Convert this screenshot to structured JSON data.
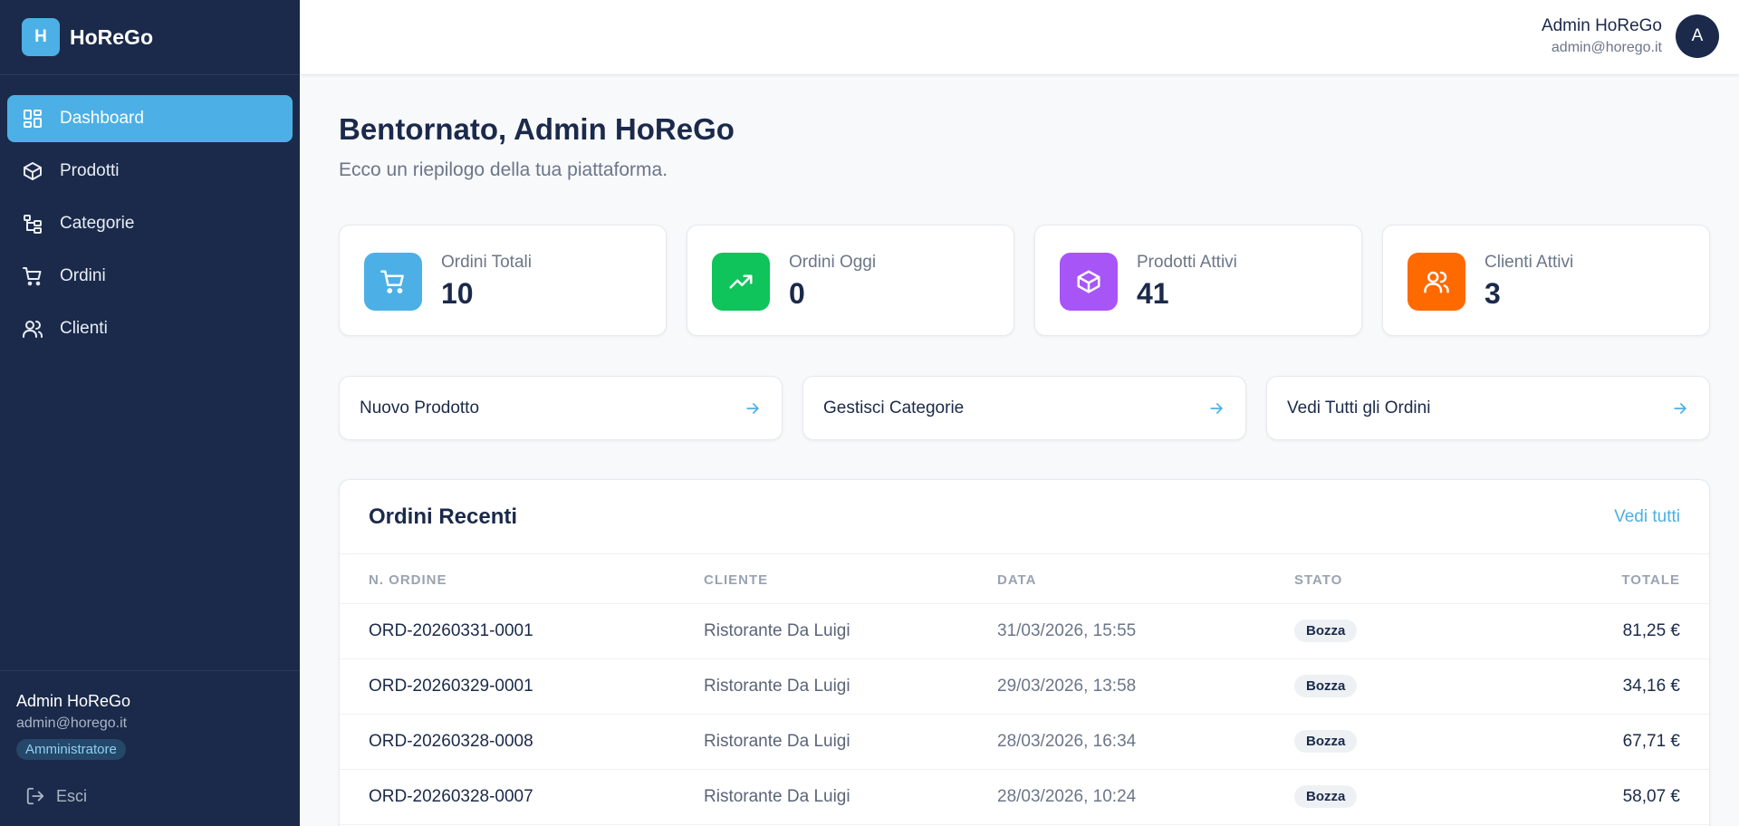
{
  "app": {
    "logo_letter": "H",
    "name": "HoReGo"
  },
  "sidebar": {
    "items": [
      {
        "label": "Dashboard",
        "icon": "dashboard-icon",
        "active": true
      },
      {
        "label": "Prodotti",
        "icon": "package-icon"
      },
      {
        "label": "Categorie",
        "icon": "category-tree-icon"
      },
      {
        "label": "Ordini",
        "icon": "cart-icon"
      },
      {
        "label": "Clienti",
        "icon": "users-icon"
      }
    ],
    "user": {
      "name": "Admin HoReGo",
      "email": "admin@horego.it",
      "role": "Amministratore"
    },
    "logout_label": "Esci"
  },
  "header": {
    "user_name": "Admin HoReGo",
    "user_email": "admin@horego.it",
    "avatar_letter": "A"
  },
  "main": {
    "title": "Bentornato, Admin HoReGo",
    "subtitle": "Ecco un riepilogo della tua piattaforma.",
    "stats": [
      {
        "label": "Ordini Totali",
        "value": "10",
        "icon": "cart-icon",
        "color": "#4cb0e6"
      },
      {
        "label": "Ordini Oggi",
        "value": "0",
        "icon": "trending-up-icon",
        "color": "#0fc45a"
      },
      {
        "label": "Prodotti Attivi",
        "value": "41",
        "icon": "package-icon",
        "color": "#a855f7"
      },
      {
        "label": "Clienti Attivi",
        "value": "3",
        "icon": "users-icon",
        "color": "#ff6a00"
      }
    ],
    "actions": [
      {
        "label": "Nuovo Prodotto"
      },
      {
        "label": "Gestisci Categorie"
      },
      {
        "label": "Vedi Tutti gli Ordini"
      }
    ],
    "recent_orders": {
      "title": "Ordini Recenti",
      "view_all": "Vedi tutti",
      "columns": [
        "N. ORDINE",
        "CLIENTE",
        "DATA",
        "STATO",
        "TOTALE"
      ],
      "rows": [
        {
          "number": "ORD-20260331-0001",
          "client": "Ristorante Da Luigi",
          "date": "31/03/2026, 15:55",
          "status": "Bozza",
          "total": "81,25 €"
        },
        {
          "number": "ORD-20260329-0001",
          "client": "Ristorante Da Luigi",
          "date": "29/03/2026, 13:58",
          "status": "Bozza",
          "total": "34,16 €"
        },
        {
          "number": "ORD-20260328-0008",
          "client": "Ristorante Da Luigi",
          "date": "28/03/2026, 16:34",
          "status": "Bozza",
          "total": "67,71 €"
        },
        {
          "number": "ORD-20260328-0007",
          "client": "Ristorante Da Luigi",
          "date": "28/03/2026, 10:24",
          "status": "Bozza",
          "total": "58,07 €"
        }
      ]
    }
  },
  "colors": {
    "sidebar_bg": "#1b2a4a",
    "accent": "#4cb0e6",
    "page_bg": "#f8f9fb"
  }
}
